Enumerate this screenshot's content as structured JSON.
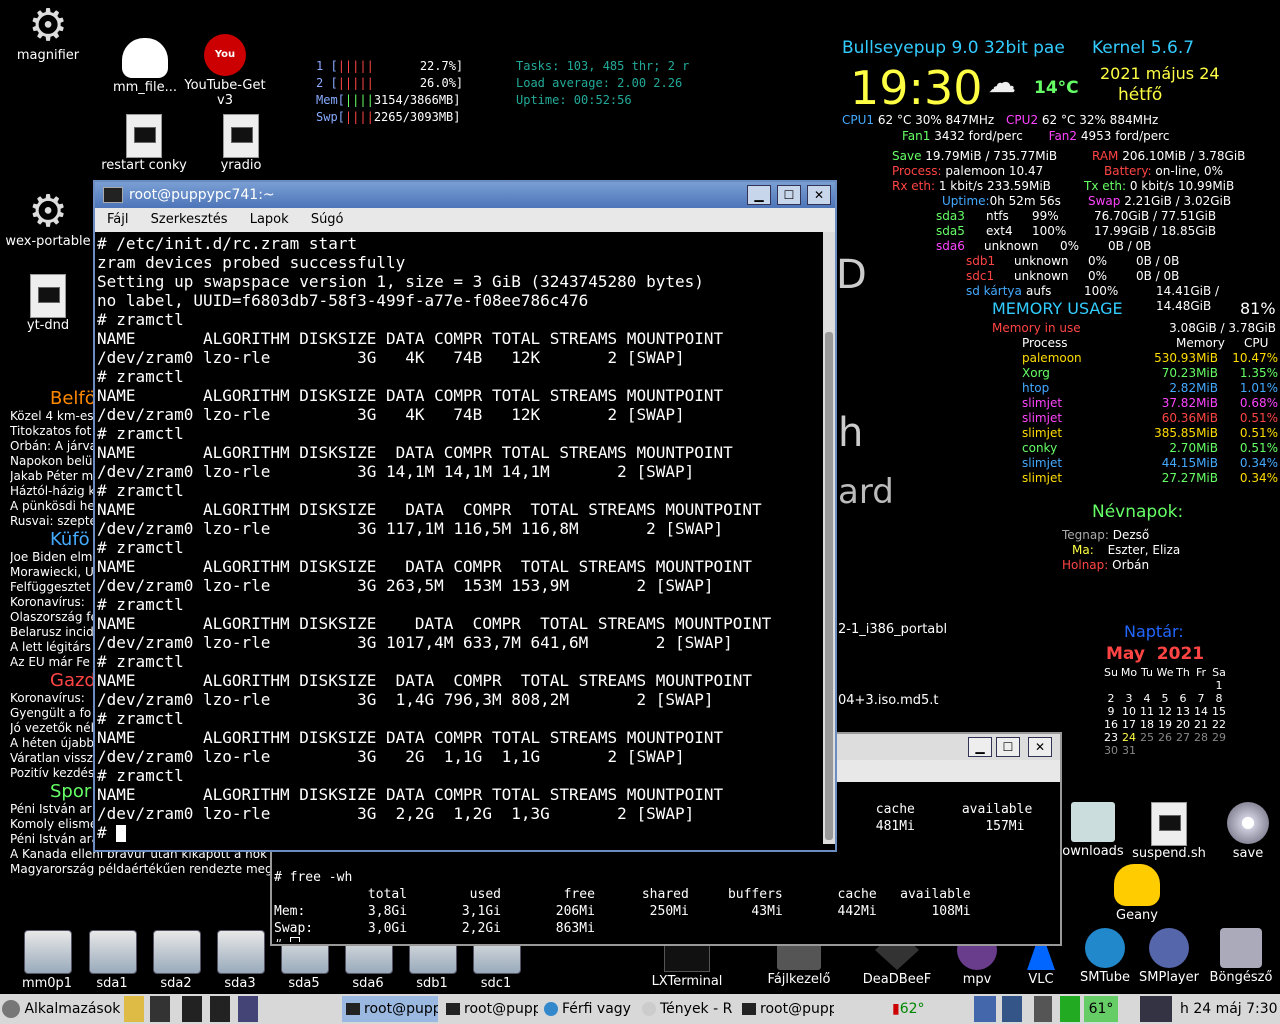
{
  "desktop_icons": {
    "magnifier": "magnifier",
    "mm_file": "mm_file...",
    "youtube_get": "YouTube-Get v3",
    "restart_conky": "restart conky",
    "yradio": "yradio",
    "wex_portable": "wex-portable",
    "yt_dnd": "yt-dnd",
    "downloads": "ownloads",
    "suspend": "suspend.sh",
    "save": "save",
    "geany": "Geany",
    "smtube": "SMTube",
    "smplayer": "SMPlayer",
    "browser": "Böngésző",
    "lxterminal": "LXTerminal",
    "filemanager": "Fájlkezelő",
    "deadbeef": "DeaDBeeF",
    "mpv": "mpv",
    "vlc": "VLC"
  },
  "drives": [
    "mm0p1",
    "sda1",
    "sda2",
    "sda3",
    "sda5",
    "sda6",
    "sdb1",
    "sdc1"
  ],
  "htop": {
    "cpu1_label": "1  [",
    "cpu1_bar": "|||||",
    "cpu1_val": "22.7%]",
    "cpu2_label": "2  [",
    "cpu2_bar": "|||||",
    "cpu2_val": "26.0%]",
    "mem_label": "Mem[",
    "mem_bar": "||||",
    "mem_val": "3154/3866MB]",
    "swp_label": "Swp[",
    "swp_bar": "||||",
    "swp_val": "2265/3093MB]",
    "tasks": "Tasks: 103, 485 thr; 2 r",
    "load": "Load average: 2.00 2.26",
    "uptime": "Uptime: 00:52:56"
  },
  "conky": {
    "distro": "Bullseyepup 9.0 32bit pae",
    "kernel": "Kernel 5.6.7",
    "time": "19:30",
    "temp": "14°C",
    "date": "2021 május 24",
    "weekday": "hétfő",
    "cpu1_line": "62 °C   30%   847MHz",
    "cpu1_label": "CPU1",
    "cpu2_label": "CPU2",
    "cpu2_line": "62 °C   32%   884MHz",
    "fan1_label": "Fan1",
    "fan1_val": "3432 ford/perc",
    "fan2_label": "Fan2",
    "fan2_val": "4953 ford/perc",
    "save_label": "Save",
    "save_val": "19.79MiB / 735.77MiB",
    "ram_label": "RAM",
    "ram_val": "206.10MiB / 3.78GiB",
    "process_label": "Process:",
    "process_val": "palemoon       10.47",
    "battery_label": "Battery:",
    "battery_val": "on-line,  0%",
    "rx_label": "Rx eth:",
    "rx_val": "1 kbit/s    233.59MiB",
    "tx_label": "Tx eth:",
    "tx_val": "0 kbit/s    10.99MiB",
    "uptime_label": "Uptime:",
    "uptime_val": "0h 52m 56s",
    "swap_label": "Swap",
    "swap_val": "2.21GiB / 3.02GiB",
    "disks": [
      {
        "name": "sda3",
        "fs": "ntfs",
        "pct": "99%",
        "val": "76.70GiB / 77.51GiB"
      },
      {
        "name": "sda5",
        "fs": "ext4",
        "pct": "100%",
        "val": "17.99GiB / 18.85GiB"
      },
      {
        "name": "sda6",
        "fs": "unknown",
        "pct": "0%",
        "val": "0B / 0B"
      },
      {
        "name": "sdb1",
        "fs": "unknown",
        "pct": "0%",
        "val": "0B / 0B"
      },
      {
        "name": "sdc1",
        "fs": "unknown",
        "pct": "0%",
        "val": "0B / 0B"
      },
      {
        "name": "sd kártya",
        "fs": "aufs",
        "pct": "100%",
        "val": "14.41GiB / 14.48GiB"
      }
    ],
    "mem_usage_title": "MEMORY USAGE",
    "mem_usage_pct": "81%",
    "mem_in_use_label": "Memory in use",
    "mem_in_use_val": "3.08GiB / 3.78GiB",
    "proc_header": {
      "process": "Process",
      "memory": "Memory",
      "cpu": "CPU"
    },
    "procs": [
      {
        "name": "palemoon",
        "mem": "530.93MiB",
        "cpu": "10.47%"
      },
      {
        "name": "Xorg",
        "mem": "70.23MiB",
        "cpu": "1.35%"
      },
      {
        "name": "htop",
        "mem": "2.82MiB",
        "cpu": "1.01%"
      },
      {
        "name": "slimjet",
        "mem": "37.82MiB",
        "cpu": "0.68%"
      },
      {
        "name": "slimjet",
        "mem": "60.36MiB",
        "cpu": "0.51%"
      },
      {
        "name": "slimjet",
        "mem": "385.85MiB",
        "cpu": "0.51%"
      },
      {
        "name": "conky",
        "mem": "2.70MiB",
        "cpu": "0.51%"
      },
      {
        "name": "slimjet",
        "mem": "44.15MiB",
        "cpu": "0.34%"
      },
      {
        "name": "slimjet",
        "mem": "27.27MiB",
        "cpu": "0.34%"
      }
    ],
    "nameday_title": "Névnapok:",
    "yesterday_label": "Tegnap:",
    "yesterday_val": "Dezső",
    "today_label": "Ma:",
    "today_val": "Eszter, Eliza",
    "tomorrow_label": "Holnap:",
    "tomorrow_val": "Orbán",
    "calendar_title": "Naptár:",
    "cal_month": "May",
    "cal_year": "2021",
    "cal_header": [
      "Su",
      "Mo",
      "Tu",
      "We",
      "Th",
      "Fr",
      "Sa"
    ],
    "cal_rows": [
      [
        "",
        "",
        "",
        "",
        "",
        "",
        "1"
      ],
      [
        "2",
        "3",
        "4",
        "5",
        "6",
        "7",
        "8"
      ],
      [
        "9",
        "10",
        "11",
        "12",
        "13",
        "14",
        "15"
      ],
      [
        "16",
        "17",
        "18",
        "19",
        "20",
        "21",
        "22"
      ],
      [
        "23",
        "24",
        "25",
        "26",
        "27",
        "28",
        "29"
      ],
      [
        "30",
        "31",
        "",
        "",
        "",
        "",
        ""
      ]
    ]
  },
  "behind_text": {
    "t1": "D",
    "t2": "h",
    "t3": "ard",
    "t4": "2-1_i386_portabl",
    "t5": "04+3.iso.md5.t"
  },
  "news": {
    "h1": "Belfö",
    "lines1": [
      "Közel 4 km-es",
      "Titokzatos fot",
      "Orbán: A járva",
      "Napokon belü",
      "Jakab Péter m",
      "Háztól-házig k",
      "A pünkösdi he",
      "Rusvai: szepte"
    ],
    "h2": "Küfö",
    "lines2": [
      "Joe Biden elm",
      "Morawiecki, U",
      "Felfüggesztet",
      "Koronavírus:",
      "Olaszország fe",
      "Belarusz incid",
      "A lett légitárs",
      "Az EU már Fe"
    ],
    "h3": "Gazd",
    "lines3": [
      "Koronavírus:",
      "Gyengült a fo",
      "Jó vezetők nél",
      "A héten újabb",
      "Váratlan vissz",
      "Pozitív kezdés"
    ],
    "h4": "Spor",
    "lines4": [
      "Péni István ar",
      "Komoly elismerésben részesült Kulman Zsó",
      "Péni István aranyérmes a sportlövő Európa",
      "A Kanada elleni bravúr után kikapott a hok",
      "Magyarország példaértékűen rendezte meg"
    ]
  },
  "term1": {
    "title": "root@puppypc741:~",
    "menu": [
      "Fájl",
      "Szerkesztés",
      "Lapok",
      "Súgó"
    ],
    "lines": [
      "# /etc/init.d/rc.zram start",
      "zram devices probed successfully",
      "Setting up swapspace version 1, size = 3 GiB (3243745280 bytes)",
      "no label, UUID=f6803db7-58f3-499f-a77e-f08ee786c476",
      "# zramctl",
      "NAME       ALGORITHM DISKSIZE DATA COMPR TOTAL STREAMS MOUNTPOINT",
      "/dev/zram0 lzo-rle         3G   4K   74B   12K       2 [SWAP]",
      "# zramctl",
      "NAME       ALGORITHM DISKSIZE DATA COMPR TOTAL STREAMS MOUNTPOINT",
      "/dev/zram0 lzo-rle         3G   4K   74B   12K       2 [SWAP]",
      "# zramctl",
      "NAME       ALGORITHM DISKSIZE  DATA COMPR TOTAL STREAMS MOUNTPOINT",
      "/dev/zram0 lzo-rle         3G 14,1M 14,1M 14,1M       2 [SWAP]",
      "# zramctl",
      "NAME       ALGORITHM DISKSIZE   DATA  COMPR  TOTAL STREAMS MOUNTPOINT",
      "/dev/zram0 lzo-rle         3G 117,1M 116,5M 116,8M       2 [SWAP]",
      "# zramctl",
      "NAME       ALGORITHM DISKSIZE   DATA COMPR  TOTAL STREAMS MOUNTPOINT",
      "/dev/zram0 lzo-rle         3G 263,5M  153M 153,9M       2 [SWAP]",
      "# zramctl",
      "NAME       ALGORITHM DISKSIZE    DATA  COMPR  TOTAL STREAMS MOUNTPOINT",
      "/dev/zram0 lzo-rle         3G 1017,4M 633,7M 641,6M       2 [SWAP]",
      "# zramctl",
      "NAME       ALGORITHM DISKSIZE  DATA  COMPR  TOTAL STREAMS MOUNTPOINT",
      "/dev/zram0 lzo-rle         3G  1,4G 796,3M 808,2M       2 [SWAP]",
      "# zramctl",
      "NAME       ALGORITHM DISKSIZE DATA COMPR TOTAL STREAMS MOUNTPOINT",
      "/dev/zram0 lzo-rle         3G   2G  1,1G  1,1G       2 [SWAP]",
      "# zramctl",
      "NAME       ALGORITHM DISKSIZE DATA COMPR TOTAL STREAMS MOUNTPOINT",
      "/dev/zram0 lzo-rle         3G  2,2G  1,2G  1,3G       2 [SWAP]"
    ],
    "prompt": "# "
  },
  "term2": {
    "top_header": "             cache      available",
    "top_values": "             481Mi         157Mi",
    "lines": [
      "# free -wh",
      "            total        used        free      shared     buffers       cache   available",
      "Mem:        3,8Gi       3,1Gi       206Mi       250Mi        43Mi       442Mi       108Mi",
      "Swap:       3,0Gi       2,2Gi       863Mi"
    ],
    "prompt": "# "
  },
  "taskbar": {
    "menu": "Alkalmazások",
    "tasks": [
      "root@pupp",
      "root@pupp",
      "Férfi vagy",
      "Tények - R",
      "root@pupp"
    ],
    "temp1": "62°",
    "temp2": "61°",
    "clock": "h 24 máj  7:30"
  }
}
